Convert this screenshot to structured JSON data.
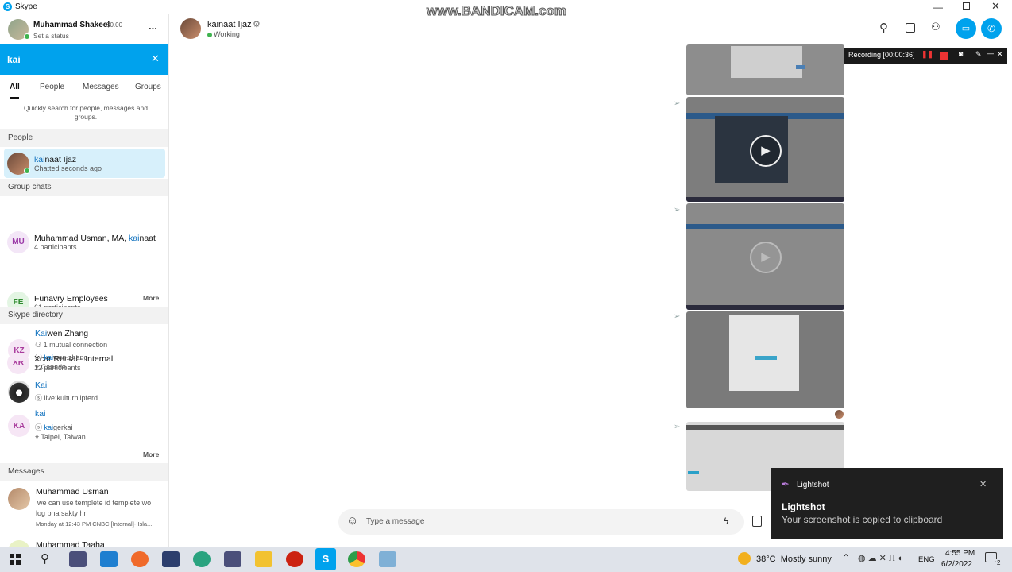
{
  "app": {
    "title": "Skype"
  },
  "watermark": "www.BANDICAM.com",
  "profile": {
    "name": "Muhammad Shakeel",
    "balance": "$0.00",
    "status": "Set a status",
    "more": "..."
  },
  "search": {
    "query": "kai",
    "hint": "Quickly search for people, messages and groups."
  },
  "tabs": [
    "All",
    "People",
    "Messages",
    "Groups"
  ],
  "sections": {
    "people": "People",
    "groups": "Group chats",
    "directory": "Skype directory",
    "messages": "Messages",
    "more": "More"
  },
  "people": [
    {
      "name_hl": "kai",
      "name_rest": "naat Ijaz",
      "sub": "Chatted seconds ago"
    }
  ],
  "groups": [
    {
      "initials": "MU",
      "name": "Muhammad Usman, MA, ",
      "name_hl": "kai",
      "name_rest": "naat",
      "sub": "4 participants",
      "bg": "#f3e6f7",
      "fg": "#9b3aa8"
    },
    {
      "initials": "FE",
      "name": "Funavry Employees",
      "sub": "61 participants",
      "bg": "#e3f5e3",
      "fg": "#2f8a2f"
    },
    {
      "initials": "XR",
      "name": "Xcar Rental - Internal",
      "sub": "12 participants",
      "bg": "#f6e6f5",
      "fg": "#a83a9c"
    }
  ],
  "directory": [
    {
      "initials": "KZ",
      "name_hl": "Kai",
      "name_rest": "wen Zhang",
      "line1": "1 mutual connection",
      "id_hl": "kai",
      "id_rest": "wen.zhang",
      "loc": "Canada"
    },
    {
      "name_hl": "Kai",
      "name_rest": "",
      "id_text": "live:kulturnilpferd"
    },
    {
      "initials": "KA",
      "name_hl": "kai",
      "name_rest": "",
      "id_hl": "kai",
      "id_rest": "gerkai",
      "loc": "Taipei, Taiwan"
    }
  ],
  "messages": [
    {
      "name": "Muhammad Usman",
      "preview1": "we can use templete id templete wo",
      "preview2": "log bna sakty hn",
      "meta": "Monday at 12:43 PM CNBC [Internal]- Isla..."
    },
    {
      "name": "Muhammad Taaha"
    }
  ],
  "chat": {
    "name": "kainaat Ijaz",
    "status": "Working",
    "input_placeholder": "Type a message"
  },
  "recording": {
    "label": "Recording [00:00:36]"
  },
  "toast": {
    "app": "Lightshot",
    "title": "Lightshot",
    "body": "Your screenshot is copied to clipboard"
  },
  "taskbar": {
    "weather": "38°C  Mostly sunny",
    "lang": "ENG",
    "time": "4:55 PM",
    "date": "6/2/2022",
    "notif": "2"
  },
  "colors": {
    "accent": "#0078d4",
    "search_bar": "#00a2ed",
    "selected": "#d7f0fb",
    "highlight": "#0a6ebd"
  }
}
